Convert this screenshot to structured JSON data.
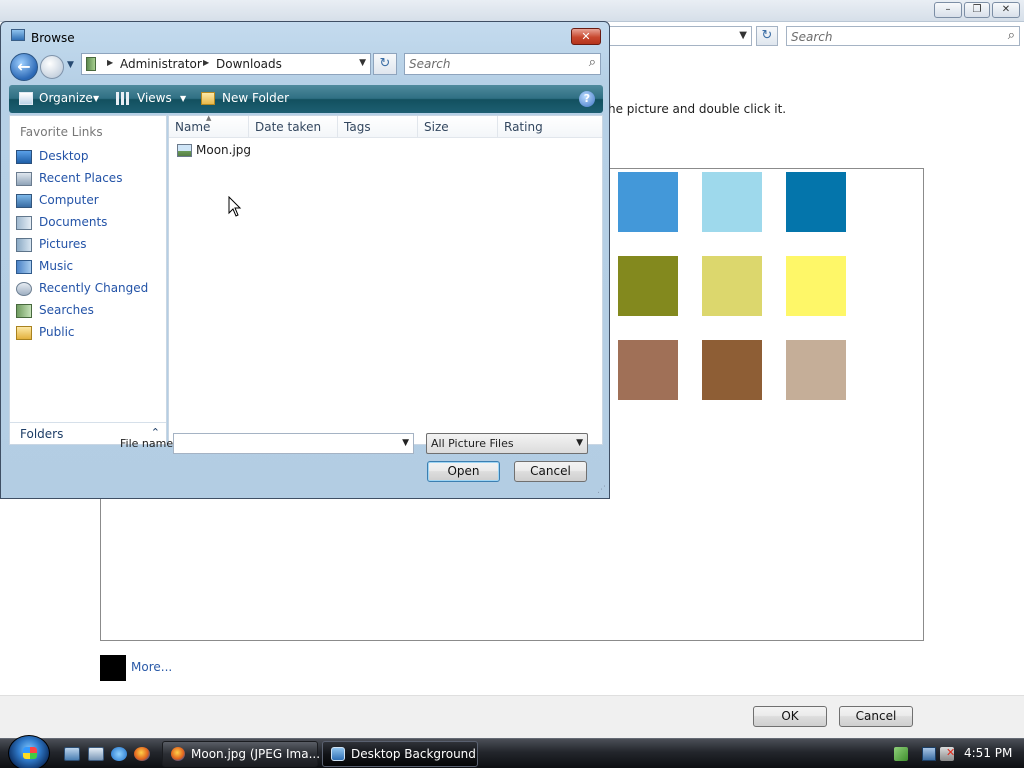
{
  "background_window": {
    "search_placeholder": "Search",
    "instruction_fragment": "he picture and double click it.",
    "swatches": [
      {
        "color": "#4398d9"
      },
      {
        "color": "#9ed9ec"
      },
      {
        "color": "#0475ab"
      },
      {
        "color": "#83891e"
      },
      {
        "color": "#dcd76d"
      },
      {
        "color": "#fef768"
      },
      {
        "color": "#a07057"
      },
      {
        "color": "#8e5e35"
      },
      {
        "color": "#c5ae98"
      }
    ],
    "more_color": "#000000",
    "more_link": "More...",
    "ok_label": "OK",
    "cancel_label": "Cancel"
  },
  "dialog": {
    "title": "Browse",
    "breadcrumb": [
      "Administrator",
      "Downloads"
    ],
    "search_placeholder": "Search",
    "toolbar": {
      "organize": "Organize",
      "views": "Views",
      "new_folder": "New Folder"
    },
    "nav": {
      "favorites_heading": "Favorite Links",
      "items": [
        {
          "label": "Desktop",
          "icon": "desktop-icon"
        },
        {
          "label": "Recent Places",
          "icon": "recent-places-icon"
        },
        {
          "label": "Computer",
          "icon": "computer-icon"
        },
        {
          "label": "Documents",
          "icon": "documents-icon"
        },
        {
          "label": "Pictures",
          "icon": "pictures-icon"
        },
        {
          "label": "Music",
          "icon": "music-icon"
        },
        {
          "label": "Recently Changed",
          "icon": "recently-changed-icon"
        },
        {
          "label": "Searches",
          "icon": "searches-icon"
        },
        {
          "label": "Public",
          "icon": "public-folder-icon"
        }
      ],
      "folders": "Folders"
    },
    "columns": [
      "Name",
      "Date taken",
      "Tags",
      "Size",
      "Rating"
    ],
    "files": [
      {
        "name": "Moon.jpg",
        "icon": "image-file-icon"
      }
    ],
    "file_name_label": "File name:",
    "file_name_value": "",
    "filter": "All Picture Files",
    "open_label": "Open",
    "cancel_label": "Cancel"
  },
  "taskbar": {
    "tasks": [
      {
        "label": "Moon.jpg (JPEG Ima..."
      },
      {
        "label": "Desktop Background"
      }
    ],
    "clock": "4:51 PM"
  }
}
